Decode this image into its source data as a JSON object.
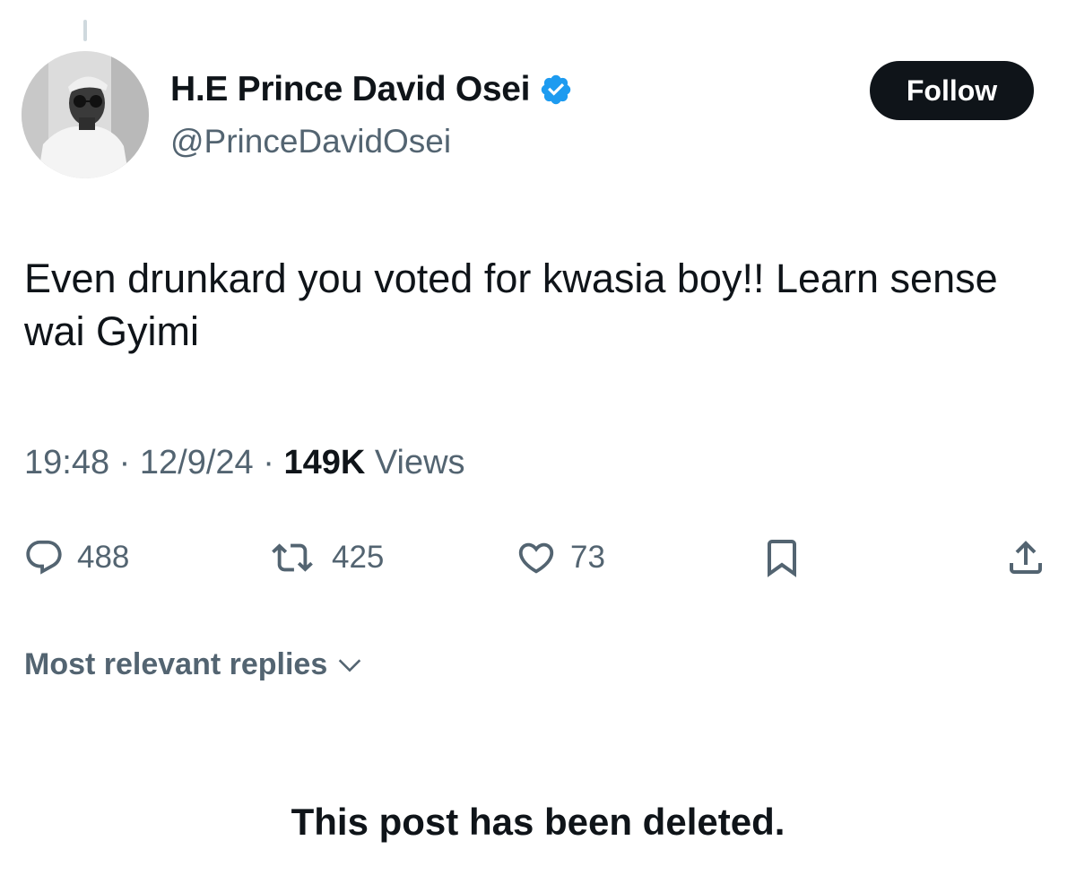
{
  "author": {
    "display_name": "H.E Prince David Osei",
    "handle": "@PrinceDavidOsei",
    "verified": true
  },
  "follow_label": "Follow",
  "post": {
    "text": "Even drunkard you voted for kwasia boy!! Learn sense wai Gyimi",
    "time": "19:48",
    "date": "12/9/24",
    "separator": "·",
    "views_count": "149K",
    "views_label": "Views"
  },
  "actions": {
    "replies": "488",
    "reposts": "425",
    "likes": "73"
  },
  "replies_sort_label": "Most relevant replies",
  "deleted_notice": "This post has been deleted.",
  "colors": {
    "text_primary": "#0f1419",
    "text_secondary": "#536471",
    "verified_blue": "#1d9bf0",
    "button_dark": "#0f1419"
  },
  "icons": [
    "verified-badge-icon",
    "reply-icon",
    "repost-icon",
    "like-icon",
    "bookmark-icon",
    "share-icon",
    "chevron-down-icon"
  ]
}
